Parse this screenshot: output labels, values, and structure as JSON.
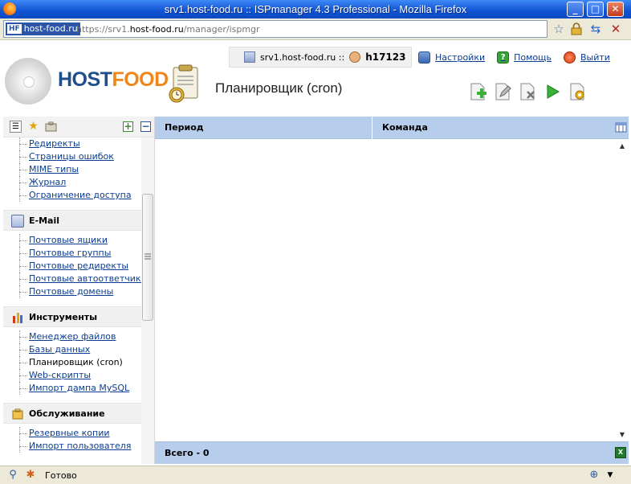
{
  "browser": {
    "window_title": "srv1.host-food.ru :: ISPmanager 4.3 Professional - Mozilla Firefox",
    "minimize": "_",
    "maximize": "□",
    "close": "✕",
    "site_identity": "host-food.ru",
    "site_identity_badge": "HF",
    "url_prefix": "https://srv1.",
    "url_host": "host-food.ru",
    "url_path": "/manager/ispmgr",
    "status_text": "Готово",
    "icons": [
      "star-icon",
      "lock-icon",
      "reload-icon",
      "stop-icon",
      "zoom-icon",
      "firebug-icon"
    ]
  },
  "header": {
    "logo_part1": "HOST",
    "logo_part2": "FOOD",
    "page_title": "Планировщик (cron)",
    "server": "srv1.host-food.ru ::",
    "user": "h17123",
    "links": {
      "settings": "Настройки",
      "help": "Помощь",
      "logout": "Выйти"
    },
    "toolbar": [
      "add-icon",
      "edit-icon",
      "delete-icon",
      "run-icon",
      "settings-icon"
    ]
  },
  "sidebar": {
    "top_items": [
      "Редиректы",
      "Страницы ошибок",
      "MIME типы",
      "Журнал",
      "Ограничение доступа"
    ],
    "groups": [
      {
        "title": "E-Mail",
        "items": [
          "Почтовые ящики",
          "Почтовые группы",
          "Почтовые редиректы",
          "Почтовые автоответчики",
          "Почтовые домены"
        ]
      },
      {
        "title": "Инструменты",
        "items": [
          "Менеджер файлов",
          "Базы данных",
          "Планировщик (cron)",
          "Web-скрипты",
          "Импорт дампа MySQL"
        ]
      },
      {
        "title": "Обслуживание",
        "items": [
          "Резервные копии",
          "Импорт пользователя"
        ]
      }
    ]
  },
  "table": {
    "columns": [
      "Период",
      "Команда"
    ],
    "rows": [],
    "footer": "Всего - 0"
  },
  "colors": {
    "titlebar": "#0f54d4",
    "table_header": "#b7cdec",
    "link": "#0b3d91",
    "brand_blue": "#1f4e8c",
    "brand_orange": "#f08519"
  }
}
